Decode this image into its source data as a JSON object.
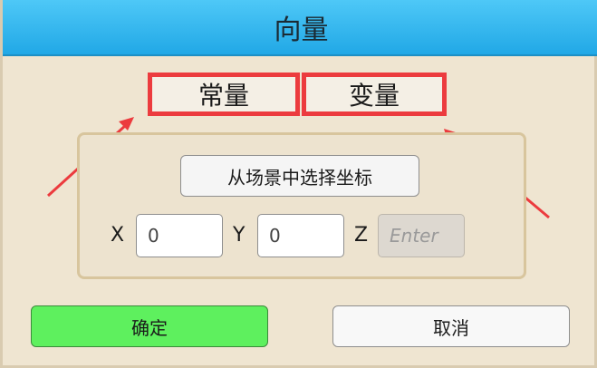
{
  "dialog": {
    "title": "向量"
  },
  "tabs": {
    "constant": "常量",
    "variable": "变量"
  },
  "panel": {
    "pick_from_scene": "从场景中选择坐标",
    "x_label": "X",
    "y_label": "Y",
    "z_label": "Z",
    "x_value": "0",
    "y_value": "0",
    "z_placeholder": "Enter"
  },
  "footer": {
    "ok_label": "确定",
    "cancel_label": "取消"
  },
  "colors": {
    "titlebar": "#21a8e6",
    "highlight": "#ec3b3e",
    "ok_button": "#5ef05e",
    "background": "#efe5d1"
  }
}
